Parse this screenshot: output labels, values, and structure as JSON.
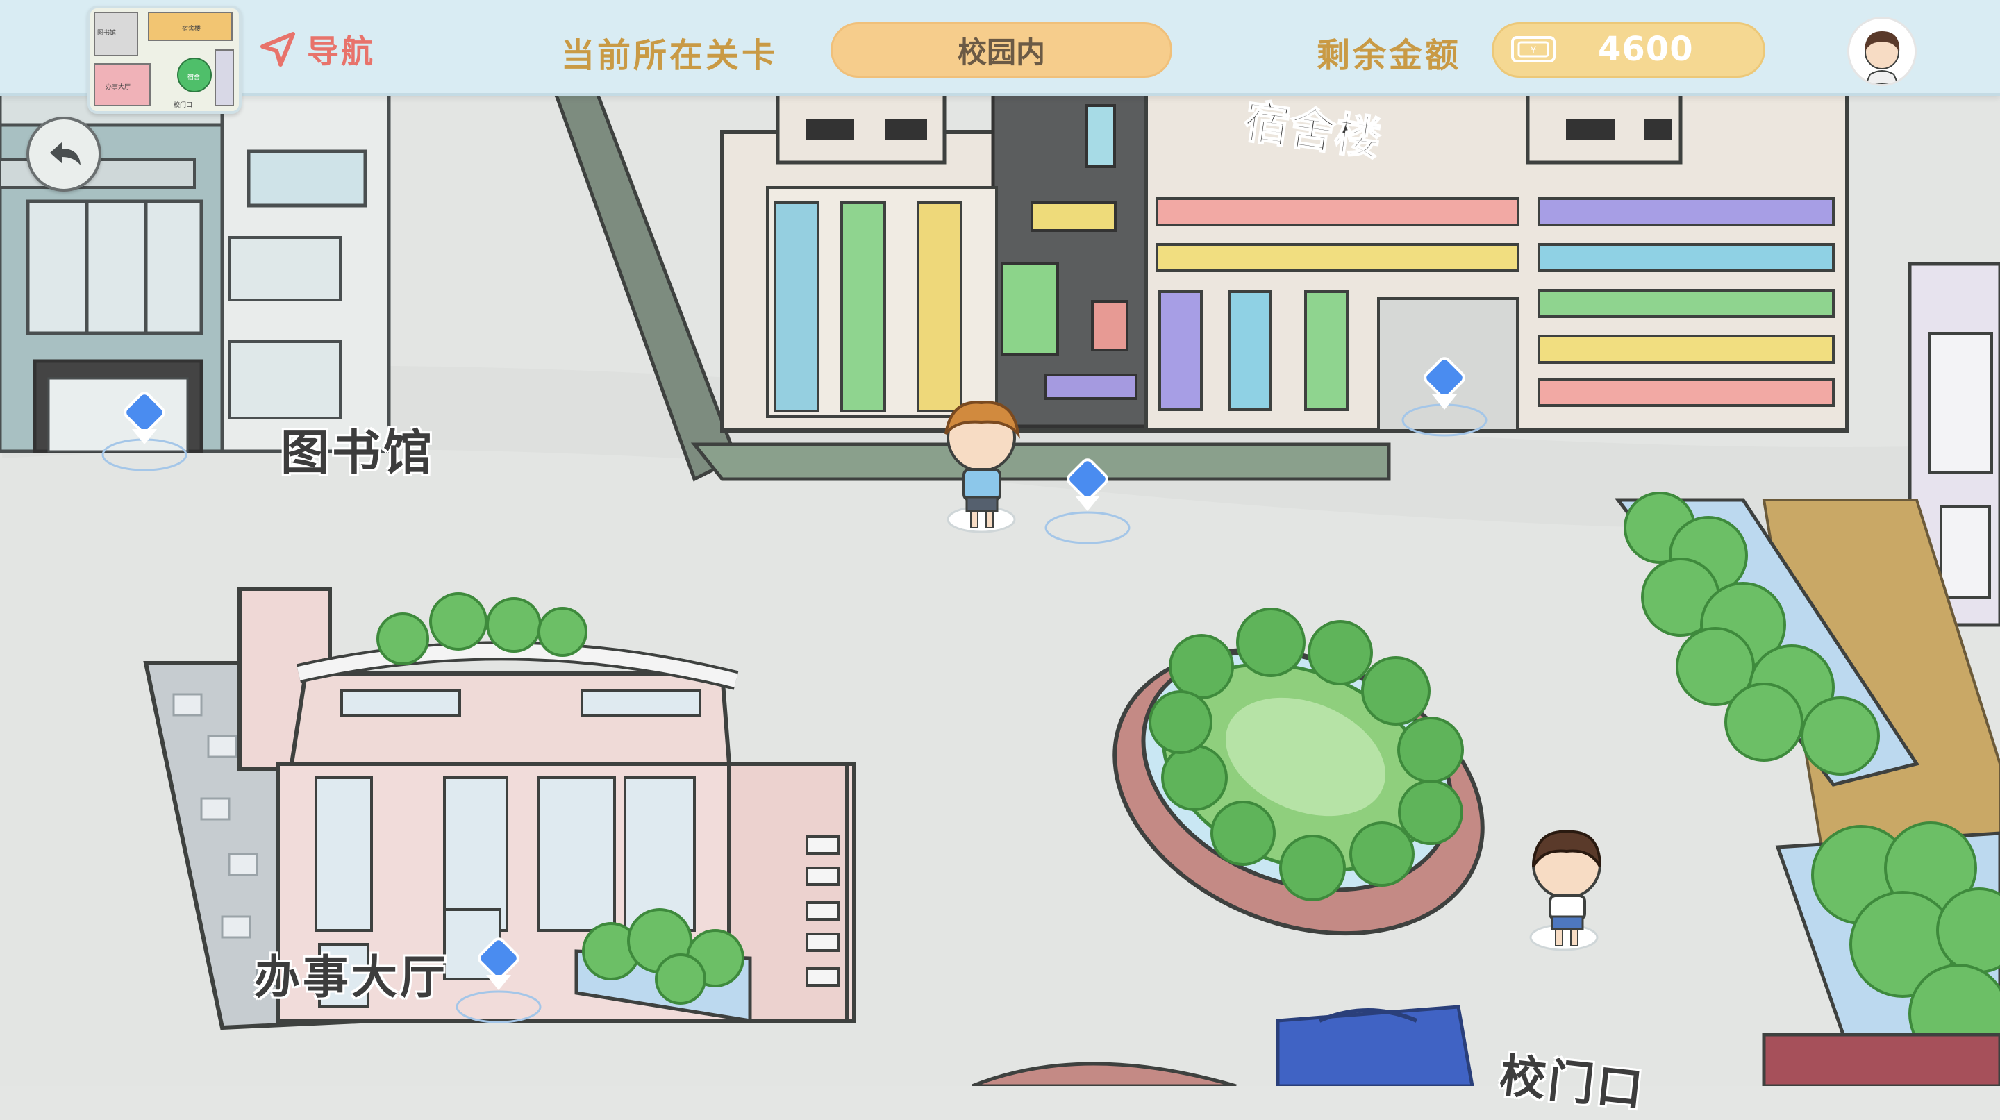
{
  "header": {
    "nav_label": "导航",
    "level_label": "当前所在关卡",
    "level_value": "校园内",
    "money_label": "剩余金额",
    "money_value": "4600",
    "money_icon": "banknote-icon",
    "nav_icon": "send-arrow-icon",
    "avatar_icon": "player-avatar"
  },
  "minimap": {
    "labels": [
      "图书馆",
      "宿舍楼",
      "宿舍",
      "办事大厅",
      "校门口"
    ]
  },
  "map": {
    "dorm_sign": "宿舍楼",
    "places": {
      "library": "图书馆",
      "office_hall": "办事大厅",
      "school_gate": "校门口"
    }
  },
  "colors": {
    "topbar": "#d9ecf3",
    "pill_level": "#f6cd8c",
    "pill_money": "#f5d892",
    "nav_accent": "#e8736b",
    "label_gold": "#c99a45",
    "marker_blue": "#4a8cf0"
  }
}
